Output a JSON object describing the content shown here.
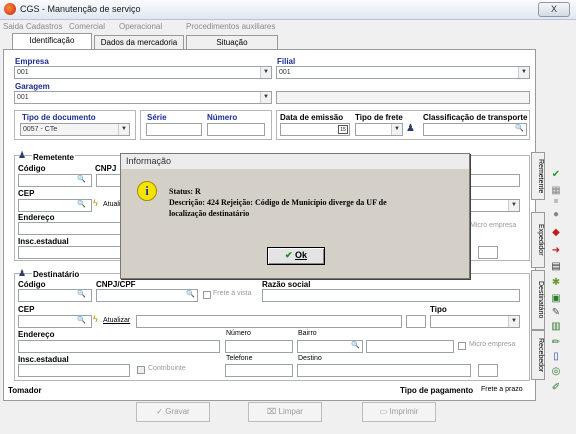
{
  "window": {
    "title": "CGS - Manutenção de serviço",
    "close": "X"
  },
  "menu": [
    "Saida",
    "Cadastros",
    "Comercial",
    "Operacional",
    "Procedimentos auxiliares"
  ],
  "tabs": [
    "Identificação",
    "Dados da mercadoria",
    "Situação"
  ],
  "form": {
    "empresa_label": "Empresa",
    "empresa_value": "001",
    "filial_label": "Filial",
    "filial_value": "001",
    "garagem_label": "Garagem",
    "garagem_value": "001",
    "tipo_doc_label": "Tipo de documento",
    "tipo_doc_value": "0057 - CTe",
    "serie_label": "Série",
    "numero_label": "Número",
    "data_emissao_label": "Data de emissão",
    "tipo_frete_label": "Tipo de frete",
    "classificacao_label": "Classificação de transporte"
  },
  "remetente": {
    "title": "Remetente",
    "codigo": "Código",
    "cnpj": "CNPJ",
    "cep": "CEP",
    "atualizar": "Atuali",
    "endereco": "Endereço",
    "insc": "Insc.estadual",
    "micro": "Micro empresa"
  },
  "destinatario": {
    "title": "Destinatário",
    "codigo": "Código",
    "cnpj": "CNPJ/CPF",
    "frete_vista": "Frete à vista",
    "razao": "Razão social",
    "cep": "CEP",
    "tipo": "Tipo",
    "atualizar": "Atualizar",
    "endereco": "Endereço",
    "numero": "Número",
    "bairro": "Bairro",
    "micro": "Micro empresa",
    "insc": "Insc.estadual",
    "contribuinte": "Contribuinte",
    "telefone": "Telefone",
    "destino": "Destino"
  },
  "footer": {
    "tomador": "Tomador",
    "tipo_pagamento_label": "Tipo de pagamento",
    "tipo_pagamento_value": "Frete a prazo"
  },
  "side_tabs": [
    "Remetente",
    "Expedidor",
    "Destinatário",
    "Recebedor"
  ],
  "buttons": {
    "gravar": "Gravar",
    "limpar": "Limpar",
    "imprimir": "Imprimir"
  },
  "dialog": {
    "title": "Informação",
    "line1": "Status: R",
    "line2": "Descrição: 424 Rejeição: Código de Município diverge da UF de",
    "line3": "localização destinatário",
    "ok": "Ok"
  },
  "icons": [
    "check-icon",
    "grid-icon",
    "list-icon",
    "circle-icon",
    "eraser-icon",
    "arrow-icon",
    "doc-icon",
    "puzzle-icon",
    "check2-icon",
    "card-icon",
    "doc2-icon",
    "pen-icon",
    "book-icon",
    "globe-icon",
    "pencil-icon"
  ]
}
